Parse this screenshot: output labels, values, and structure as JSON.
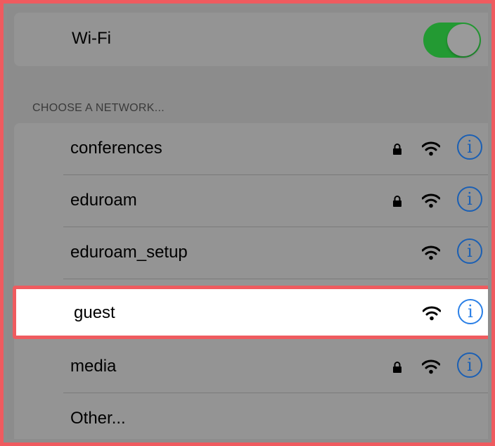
{
  "wifi": {
    "label": "Wi-Fi",
    "enabled": true,
    "toggle_color": "#239a33"
  },
  "section_header": "CHOOSE A NETWORK...",
  "networks": [
    {
      "name": "conferences",
      "secured": true,
      "info_icon": "info-icon"
    },
    {
      "name": "eduroam",
      "secured": true,
      "info_icon": "info-icon"
    },
    {
      "name": "eduroam_setup",
      "secured": false,
      "info_icon": "info-icon"
    },
    {
      "name": "guest",
      "secured": false,
      "info_icon": "info-icon",
      "highlighted": true
    },
    {
      "name": "media",
      "secured": true,
      "info_icon": "info-icon"
    }
  ],
  "other_label": "Other...",
  "info_glyph": "i",
  "colors": {
    "highlight_border": "#ef5b5f",
    "info_blue": "#1a5fb4"
  }
}
